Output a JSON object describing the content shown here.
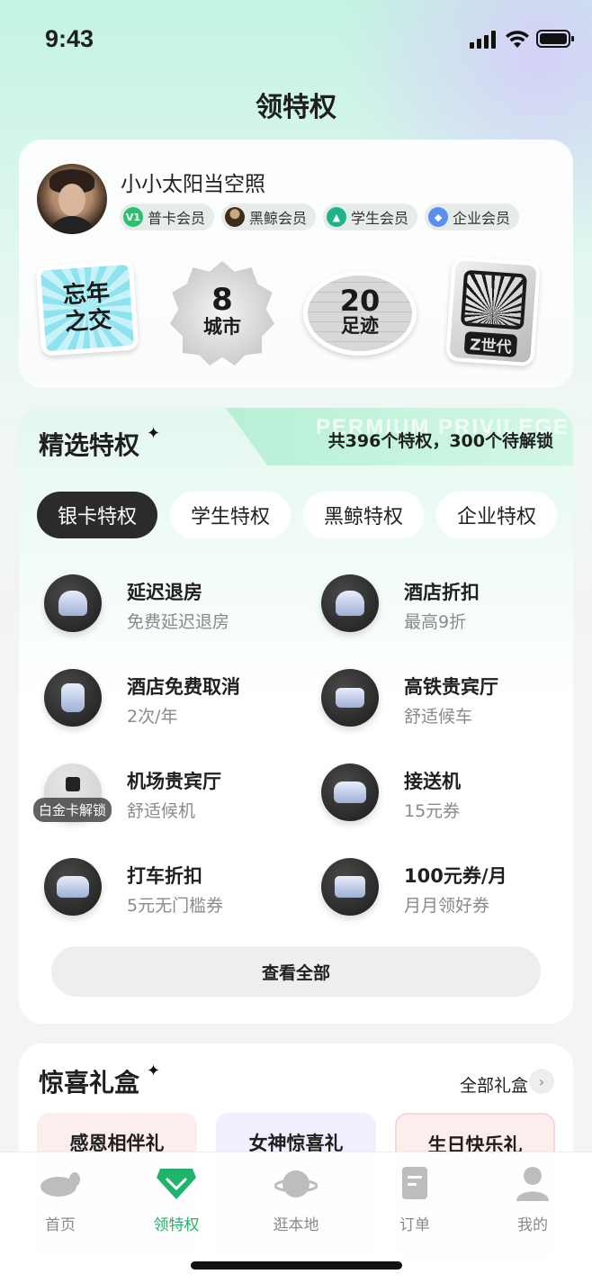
{
  "status_bar": {
    "time": "9:43"
  },
  "page_title": "领特权",
  "profile": {
    "username": "小小太阳当空照",
    "badges": [
      {
        "label": "普卡会员",
        "icon": "v1-icon",
        "icon_text": "V1",
        "color": "#2cc06f"
      },
      {
        "label": "黑鲸会员",
        "icon": "whale-icon",
        "color": "#6b5436"
      },
      {
        "label": "学生会员",
        "icon": "graduation-cap-icon",
        "color": "#1fb38a"
      },
      {
        "label": "企业会员",
        "icon": "diamond-icon",
        "color": "#5b8ef0"
      }
    ],
    "stickers": {
      "s1": "忘年\n之交",
      "s2_num": "8",
      "s2_label": "城市",
      "s3_num": "20",
      "s3_label": "足迹",
      "s4_label": "Z世代"
    }
  },
  "privileges": {
    "title": "精选特权",
    "watermark": "PERMIUM PRIVILEGE",
    "count_text": "共396个特权，300个待解锁",
    "tabs": [
      "银卡特权",
      "学生特权",
      "黑鲸特权",
      "企业特权"
    ],
    "items": [
      {
        "name": "延迟退房",
        "desc": "免费延迟退房",
        "icon": "house-clock-icon"
      },
      {
        "name": "酒店折扣",
        "desc": "最高9折",
        "icon": "house-discount-icon"
      },
      {
        "name": "酒店免费取消",
        "desc": "2次/年",
        "icon": "door-cancel-icon"
      },
      {
        "name": "高铁贵宾厅",
        "desc": "舒适候车",
        "icon": "sofa-icon"
      },
      {
        "name": "机场贵宾厅",
        "desc": "舒适候机",
        "icon": "lock-icon",
        "lock_text": "白金卡解锁"
      },
      {
        "name": "接送机",
        "desc": "15元券",
        "icon": "car-icon"
      },
      {
        "name": "打车折扣",
        "desc": "5元无门槛券",
        "icon": "car-discount-icon"
      },
      {
        "name": "100元券/月",
        "desc": "月月领好券",
        "icon": "coupon-yuan-icon"
      }
    ],
    "view_all": "查看全部"
  },
  "gifts": {
    "title": "惊喜礼盒",
    "all_label": "全部礼盒",
    "tiles": [
      {
        "label": "感恩相伴礼",
        "color": "#fdeeee"
      },
      {
        "label": "女神惊喜礼",
        "color": "#f3eefd"
      },
      {
        "label": "生日快乐礼",
        "color": "#fdeeee"
      }
    ]
  },
  "nav": {
    "items": [
      {
        "label": "首页",
        "icon": "whale-home-icon"
      },
      {
        "label": "领特权",
        "icon": "privilege-gem-icon",
        "active": true
      },
      {
        "label": "逛本地",
        "icon": "planet-icon"
      },
      {
        "label": "订单",
        "icon": "order-icon"
      },
      {
        "label": "我的",
        "icon": "profile-icon"
      }
    ]
  },
  "colors": {
    "accent": "#1fb36e",
    "dark": "#2b2b2b"
  }
}
